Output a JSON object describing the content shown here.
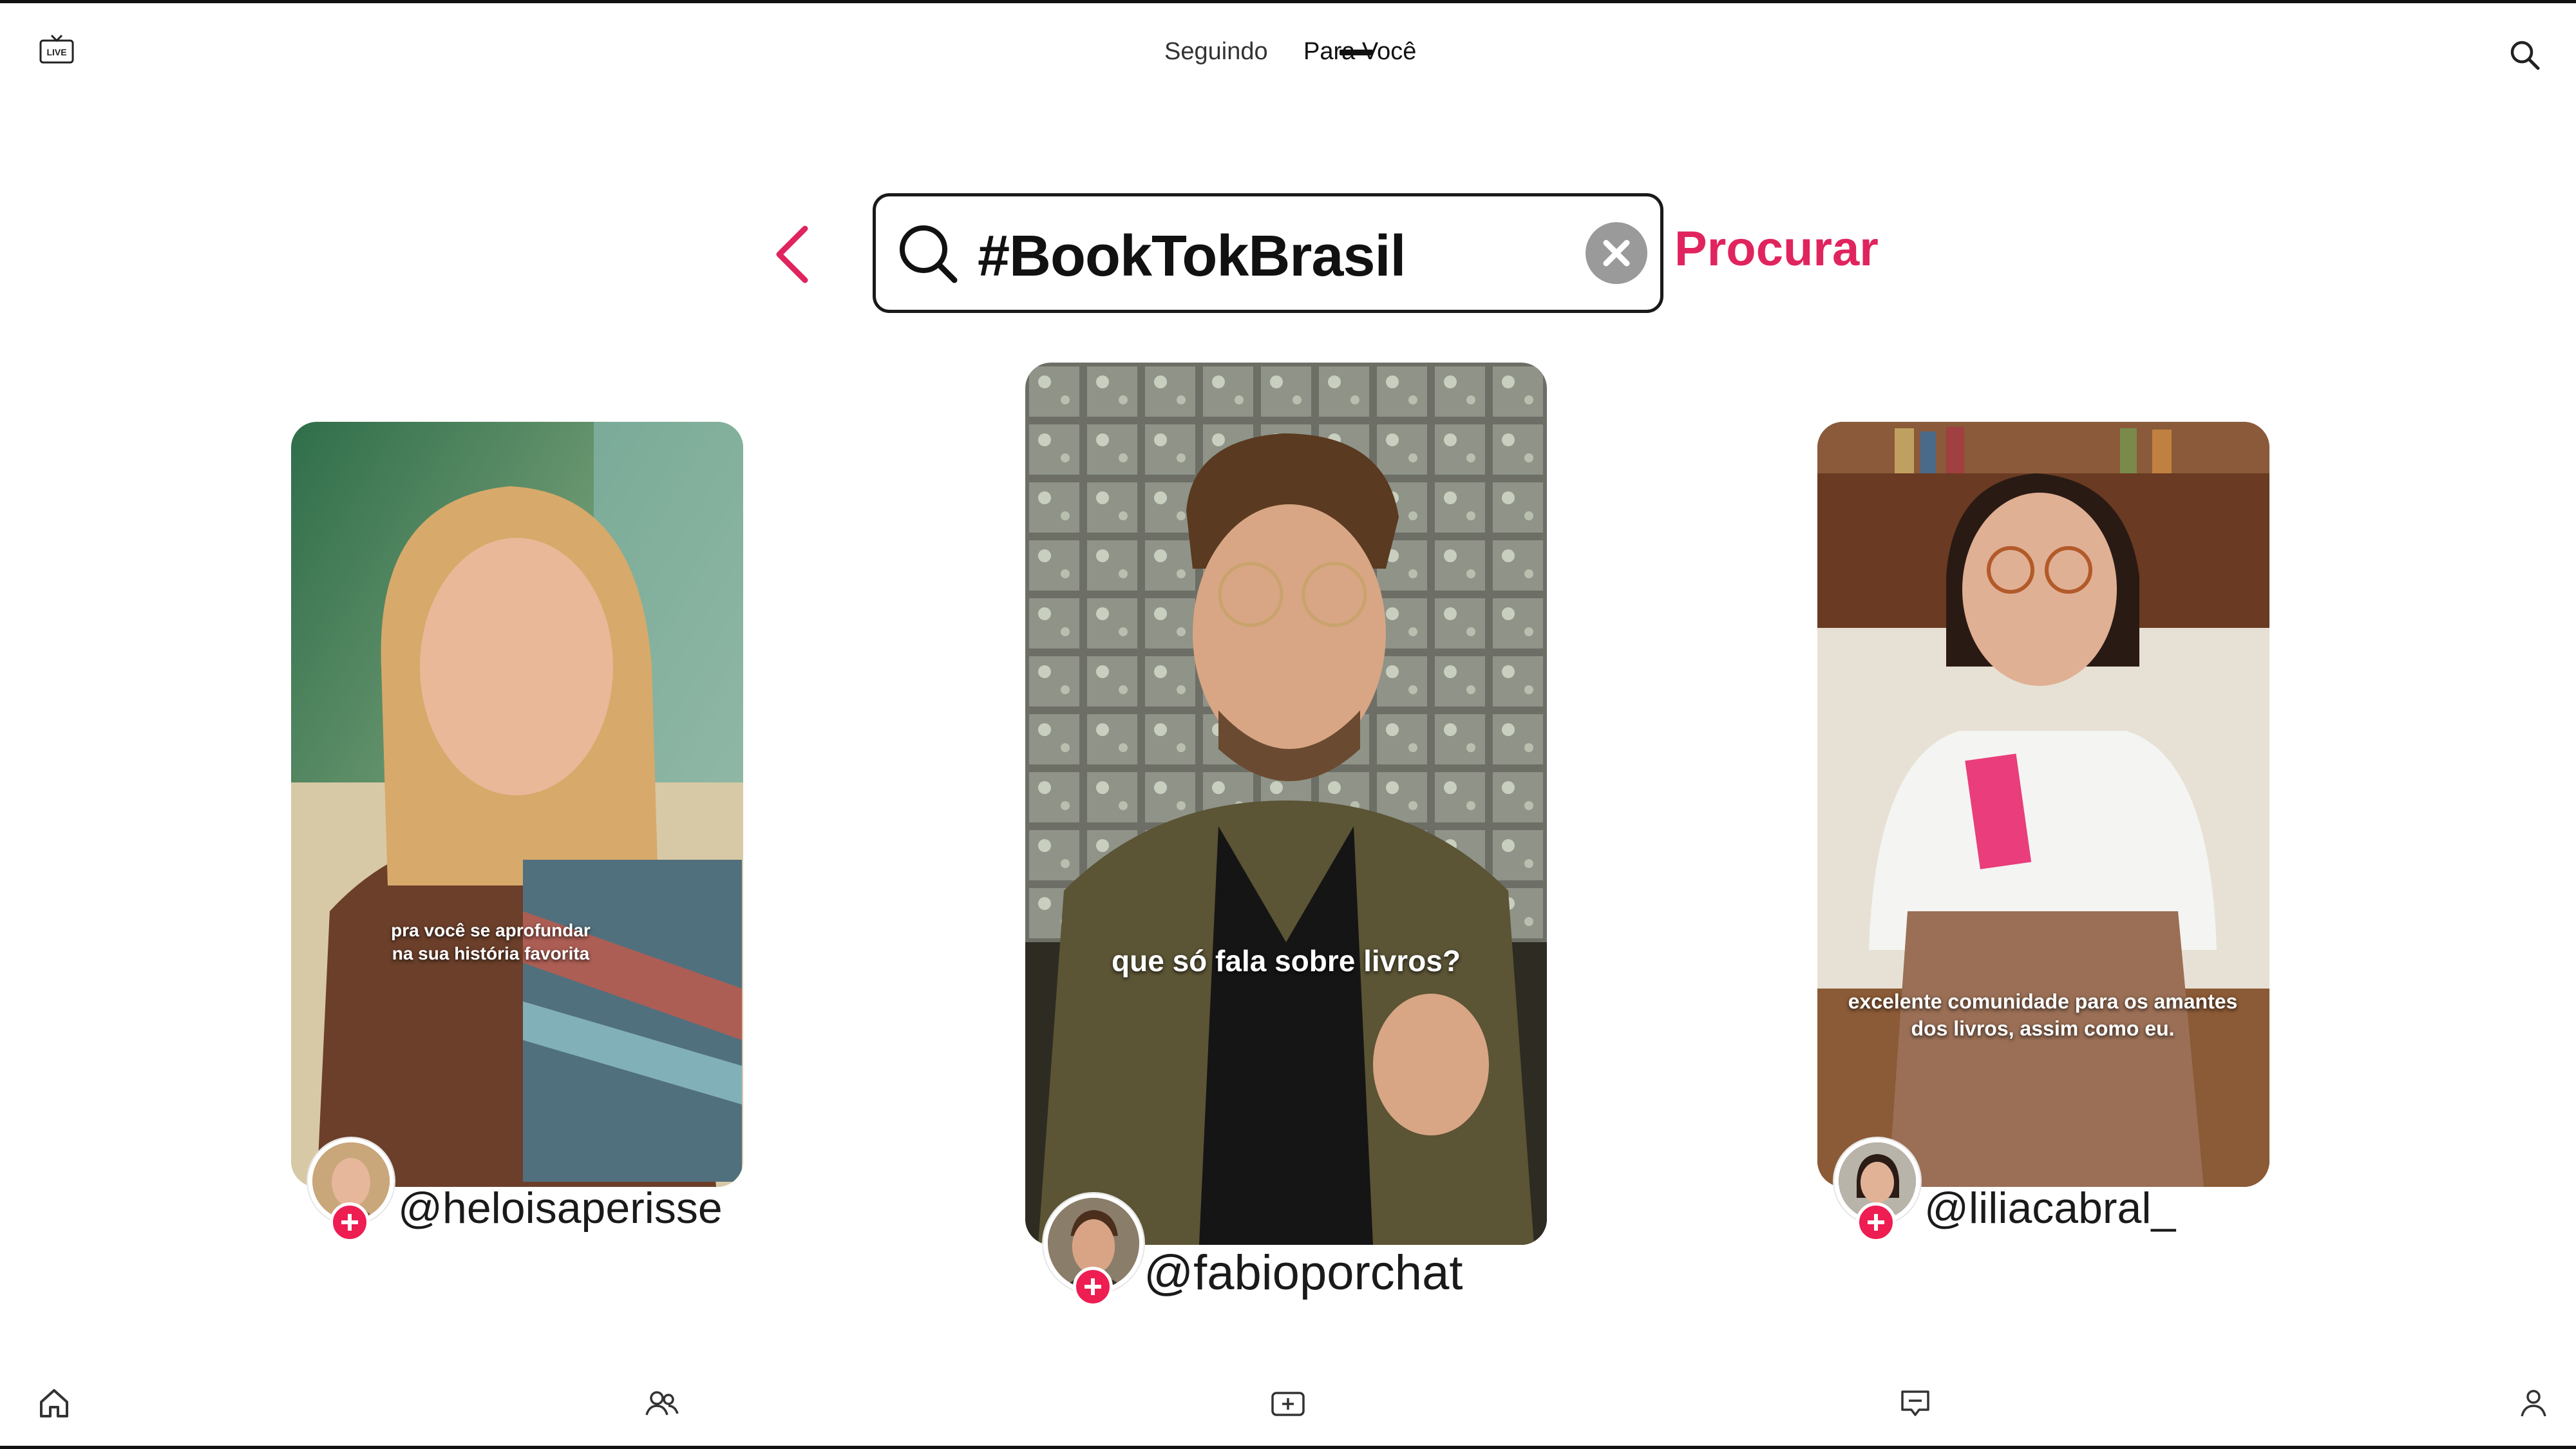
{
  "header": {
    "live_icon": "live-tv-icon",
    "tabs": [
      {
        "label": "Seguindo",
        "active": false
      },
      {
        "label": "Para Você",
        "active": true
      }
    ],
    "search_icon": "search-icon"
  },
  "search": {
    "query": "#BookTokBrasil",
    "submit_label": "Procurar",
    "accent_color": "#e0245e",
    "back_icon": "chevron-left-icon",
    "clear_icon": "clear-x-icon"
  },
  "videos": [
    {
      "handle": "@heloisaperisse",
      "caption": "pra você se aprofundar na sua história favorita"
    },
    {
      "handle": "@fabioporchat",
      "caption": "que só fala sobre livros?"
    },
    {
      "handle": "@liliacabral_",
      "caption": "excelente comunidade para os amantes dos livros, assim como eu."
    }
  ],
  "bottom_nav": [
    {
      "icon": "home-icon"
    },
    {
      "icon": "friends-icon"
    },
    {
      "icon": "create-icon"
    },
    {
      "icon": "inbox-icon"
    },
    {
      "icon": "profile-icon"
    }
  ]
}
